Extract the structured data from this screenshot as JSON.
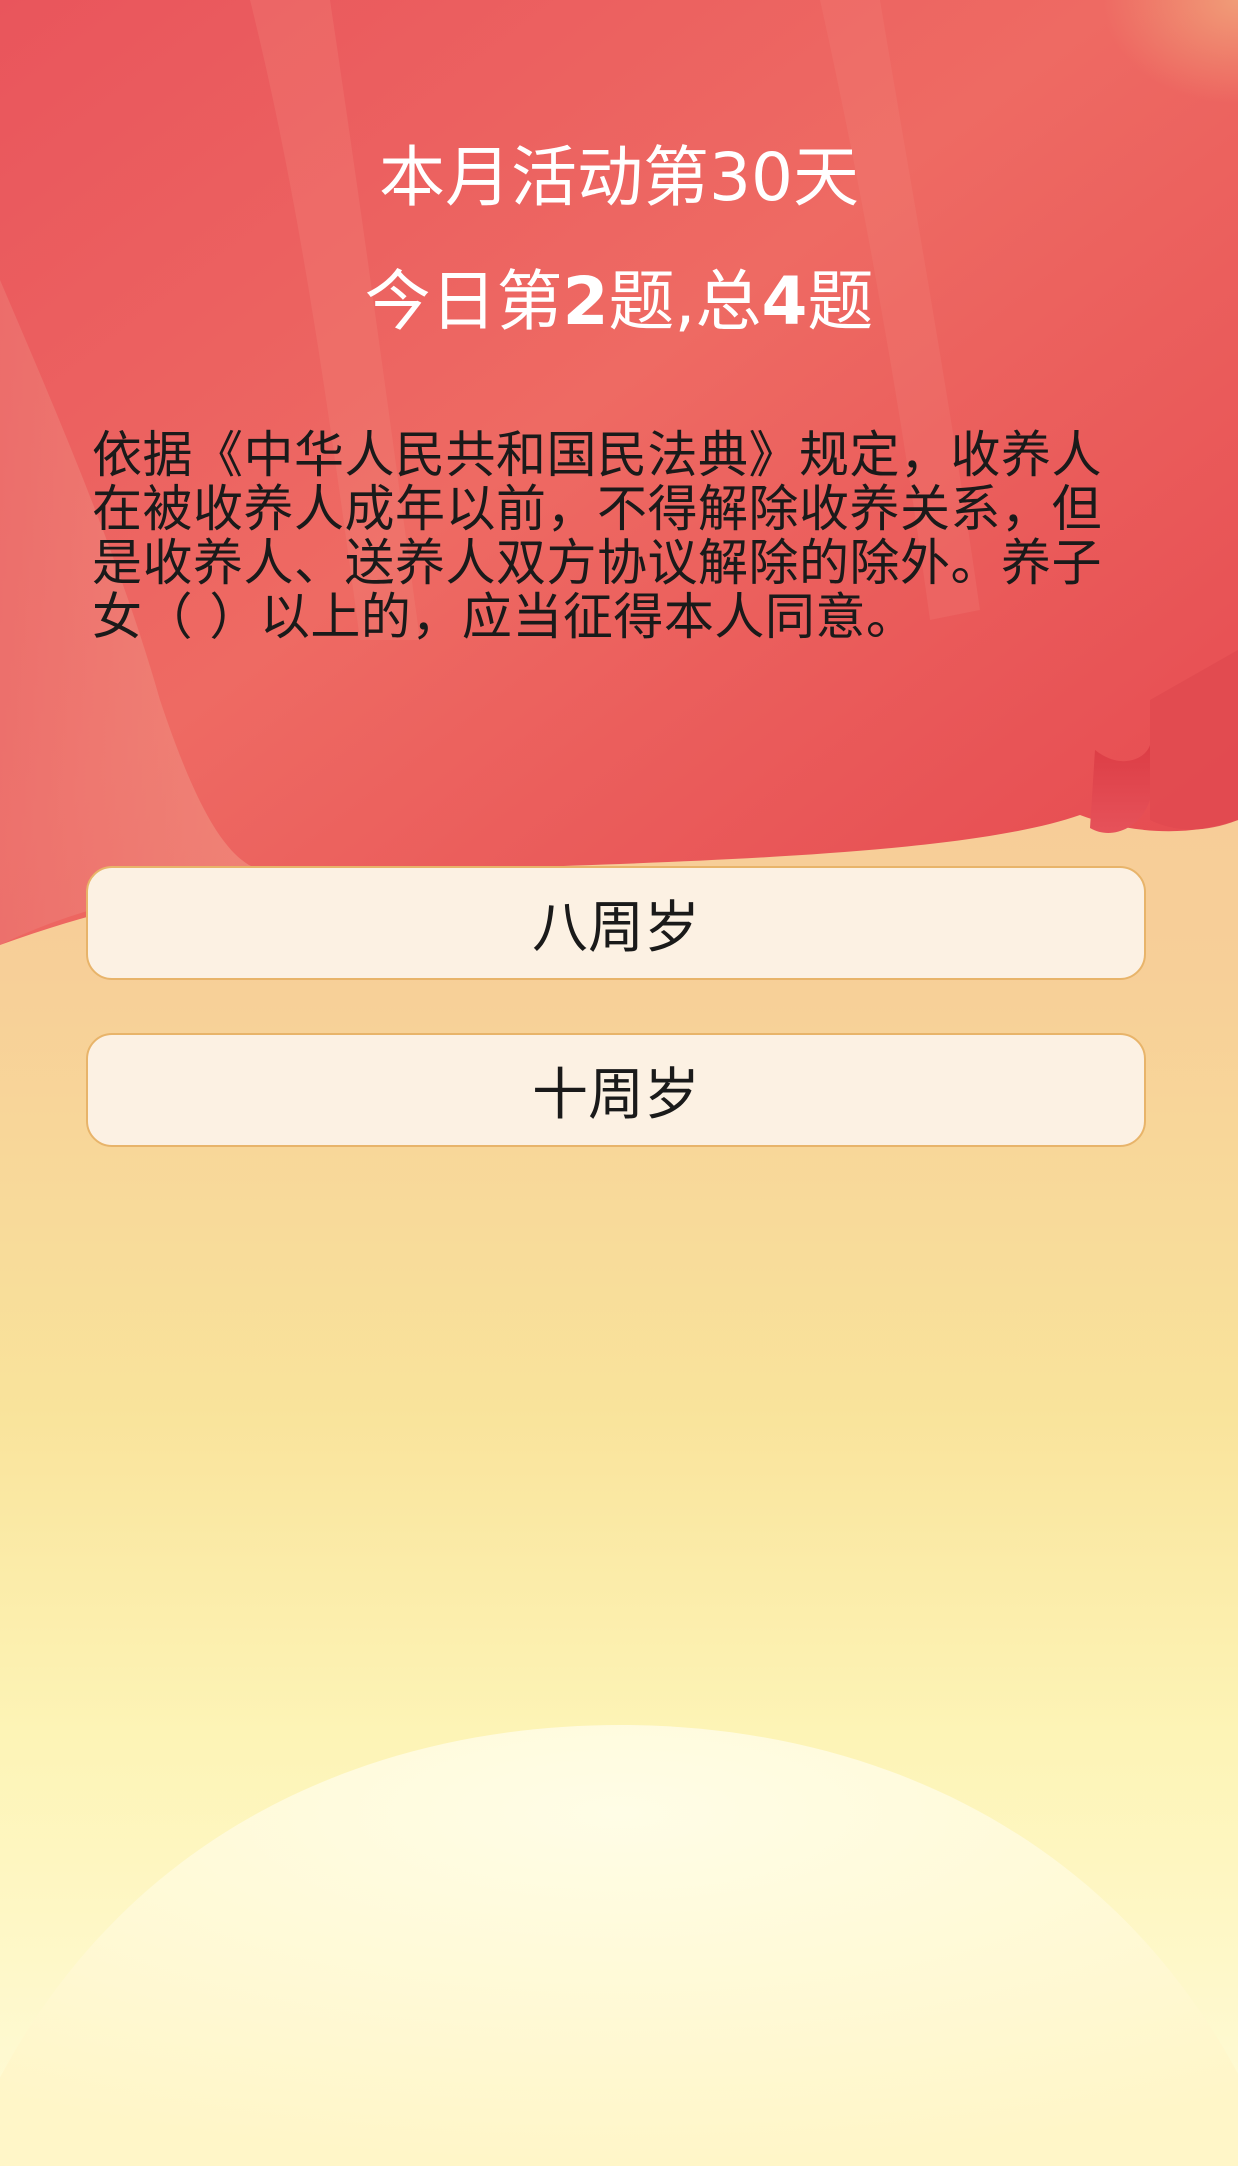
{
  "header": {
    "title": "本月活动第30天",
    "progress_prefix": "今日第",
    "current_question": "2",
    "progress_middle": "题,总",
    "total_questions": "4",
    "progress_suffix": "题"
  },
  "question": {
    "text": "依据《中华人民共和国民法典》规定，收养人在被收养人成年以前，不得解除收养关系，但是收养人、送养人双方协议解除的除外。养子女（ ）以上的，应当征得本人同意。"
  },
  "options": [
    {
      "label": "八周岁"
    },
    {
      "label": "十周岁"
    }
  ],
  "colors": {
    "banner_red": "#e8525a",
    "text_white": "#ffffff",
    "option_bg": "#fcf1e3",
    "option_border": "#e8b46a"
  }
}
